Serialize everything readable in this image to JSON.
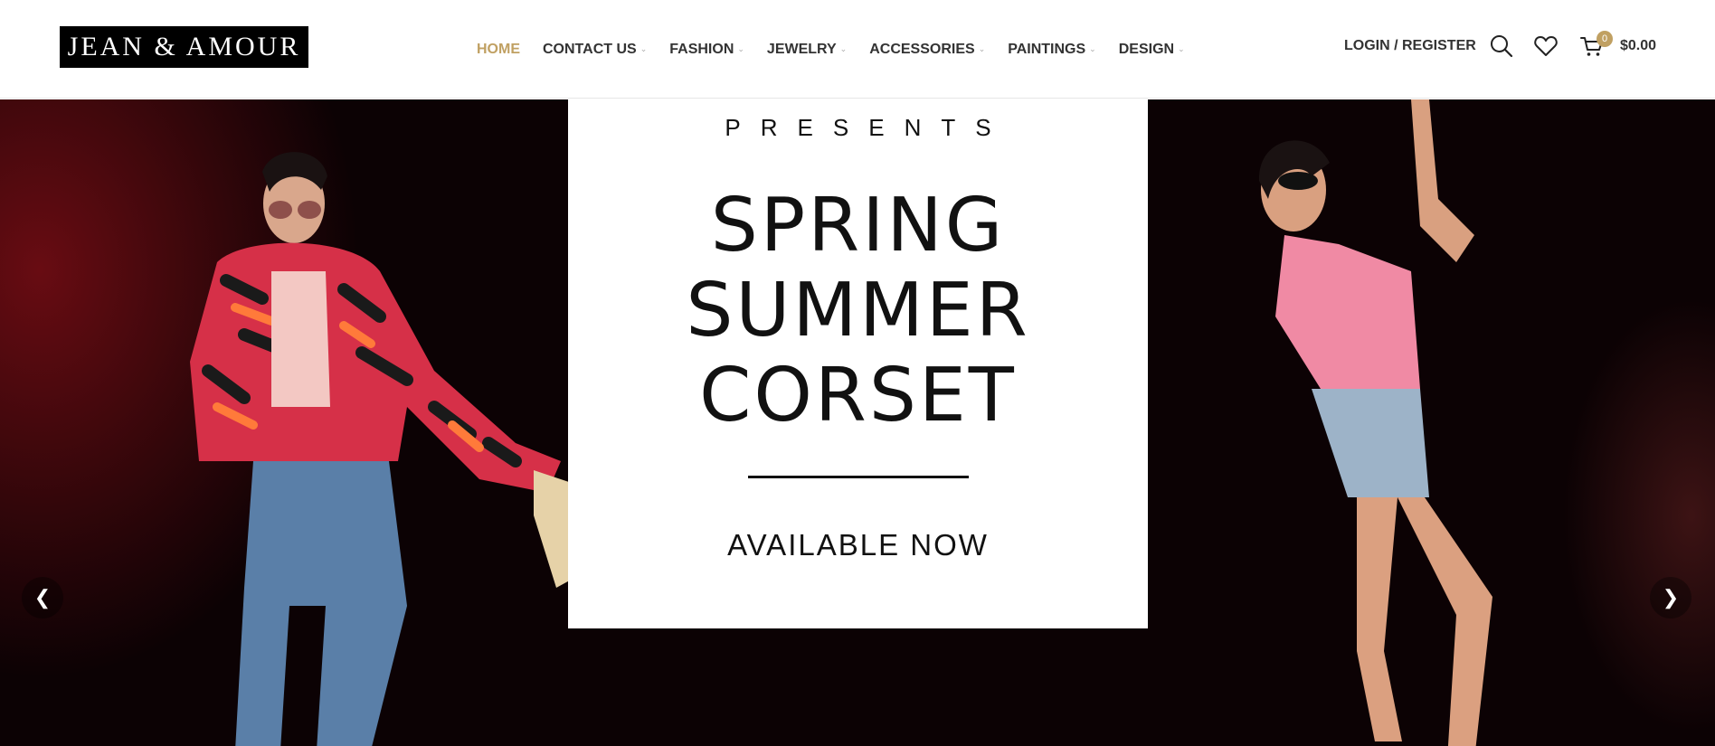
{
  "brand": {
    "logo_text": "JEAN & AMOUR",
    "accent_color": "#c0a062"
  },
  "nav": {
    "items": [
      {
        "label": "HOME",
        "active": true,
        "has_dropdown": false
      },
      {
        "label": "CONTACT US",
        "active": false,
        "has_dropdown": true
      },
      {
        "label": "FASHION",
        "active": false,
        "has_dropdown": true
      },
      {
        "label": "JEWELRY",
        "active": false,
        "has_dropdown": true
      },
      {
        "label": "ACCESSORIES",
        "active": false,
        "has_dropdown": true
      },
      {
        "label": "PAINTINGS",
        "active": false,
        "has_dropdown": true
      },
      {
        "label": "DESIGN",
        "active": false,
        "has_dropdown": true
      }
    ],
    "dropdown_glyph": "⌄"
  },
  "header_tools": {
    "login_label": "LOGIN / REGISTER",
    "search_icon": "search-icon",
    "wishlist_icon": "heart-icon",
    "cart_icon": "cart-icon",
    "cart_count": "0",
    "cart_total": "$0.00"
  },
  "hero": {
    "presents": "PRESENTS",
    "headline_lines": [
      "SPRING",
      "SUMMER",
      "CORSET"
    ],
    "cta": "AVAILABLE NOW",
    "prev_glyph": "❮",
    "next_glyph": "❯",
    "background_color": "#0c0204"
  }
}
